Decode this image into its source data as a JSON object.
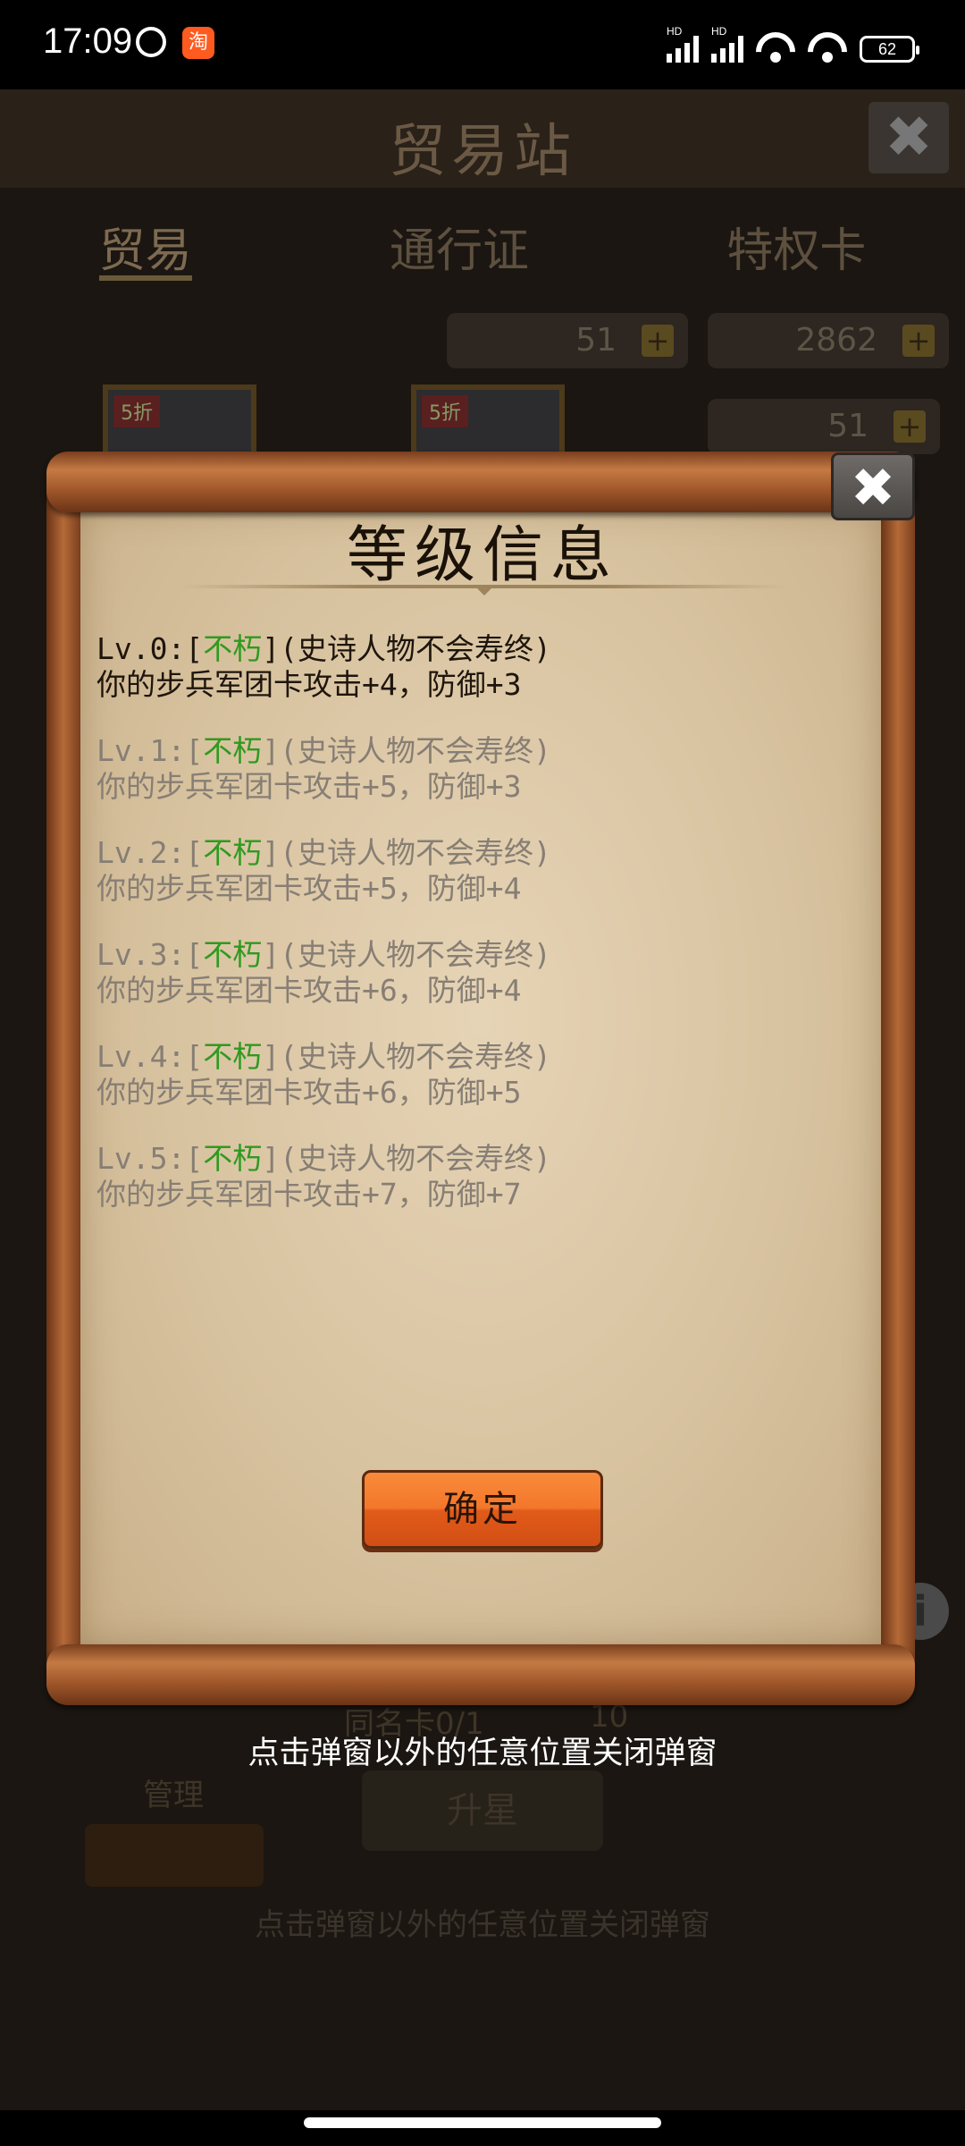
{
  "status_bar": {
    "time": "17:09",
    "app_badge": "淘",
    "signal_label_1": "HD",
    "signal_label_2": "HD",
    "battery": "62"
  },
  "background": {
    "title": "贸易站",
    "close_glyph": "✖",
    "tabs": [
      "贸易",
      "通行证",
      "特权卡"
    ],
    "currency_1": "51",
    "currency_2": "2862",
    "currency_3": "51",
    "discount_tag": "5折",
    "card_count": "同名卡0/1",
    "card_cost": "10",
    "manage_label": "管理",
    "star_up_label": "升星",
    "hint": "点击弹窗以外的任意位置关闭弹窗",
    "info_glyph": "i"
  },
  "modal": {
    "title": "等级信息",
    "close_glyph": "✖",
    "levels": [
      {
        "prefix": "Lv.0:[",
        "trait": "不朽",
        "suffix": "](史诗人物不会寿终)",
        "effect": "你的步兵军团卡攻击+4，防御+3"
      },
      {
        "prefix": "Lv.1:[",
        "trait": "不朽",
        "suffix": "](史诗人物不会寿终)",
        "effect": "你的步兵军团卡攻击+5，防御+3"
      },
      {
        "prefix": "Lv.2:[",
        "trait": "不朽",
        "suffix": "](史诗人物不会寿终)",
        "effect": "你的步兵军团卡攻击+5，防御+4"
      },
      {
        "prefix": "Lv.3:[",
        "trait": "不朽",
        "suffix": "](史诗人物不会寿终)",
        "effect": "你的步兵军团卡攻击+6，防御+4"
      },
      {
        "prefix": "Lv.4:[",
        "trait": "不朽",
        "suffix": "](史诗人物不会寿终)",
        "effect": "你的步兵军团卡攻击+6，防御+5"
      },
      {
        "prefix": "Lv.5:[",
        "trait": "不朽",
        "suffix": "](史诗人物不会寿终)",
        "effect": "你的步兵军团卡攻击+7，防御+7"
      }
    ],
    "confirm_label": "确定"
  },
  "close_hint": "点击弹窗以外的任意位置关闭弹窗",
  "colors": {
    "trait_green": "#2f9a1f",
    "button_orange": "#f3772b"
  }
}
